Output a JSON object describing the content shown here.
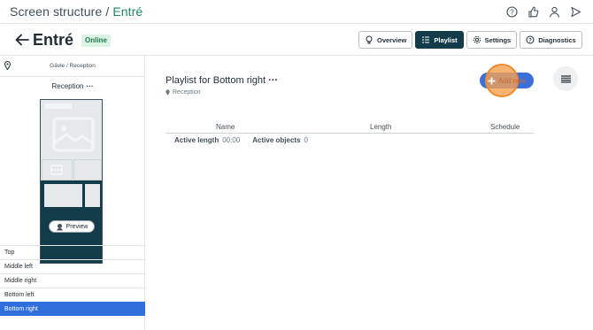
{
  "breadcrumb": {
    "parent": "Screen structure",
    "separator": "/",
    "current": "Entré"
  },
  "top_icons": [
    "help-icon",
    "thumbs-up-icon",
    "user-icon",
    "send-icon"
  ],
  "header": {
    "title": "Entré",
    "status": "Online",
    "tabs": [
      {
        "label": "Overview",
        "icon": "bulb-icon",
        "active": false
      },
      {
        "label": "Playlist",
        "icon": "list-icon",
        "active": true
      },
      {
        "label": "Settings",
        "icon": "gear-icon",
        "active": false
      },
      {
        "label": "Diagnostics",
        "icon": "question-icon",
        "active": false
      }
    ]
  },
  "sidebar": {
    "location": "Gävle / Reception",
    "screen_name": "Reception",
    "dots": "···",
    "preview_label": "Preview",
    "zones": [
      {
        "label": "Top",
        "selected": false
      },
      {
        "label": "Middle left",
        "selected": false
      },
      {
        "label": "Middle right",
        "selected": false
      },
      {
        "label": "Bottom left",
        "selected": false
      },
      {
        "label": "Bottom right",
        "selected": true
      }
    ]
  },
  "main": {
    "playlist_title": "Playlist for Bottom right",
    "dots": "···",
    "location": "Reception",
    "add_new_label": "Add new",
    "columns": {
      "name": "Name",
      "length": "Length",
      "schedule": "Schedule"
    },
    "summary": {
      "active_length_label": "Active length",
      "active_length_value": "00:00",
      "active_objects_label": "Active objects",
      "active_objects_value": "0"
    }
  },
  "colors": {
    "accent": "#123c4a",
    "selection": "#2f6fdc",
    "button": "#3b6fd9",
    "online": "#1d7a4d",
    "highlight": "#f08a30"
  }
}
